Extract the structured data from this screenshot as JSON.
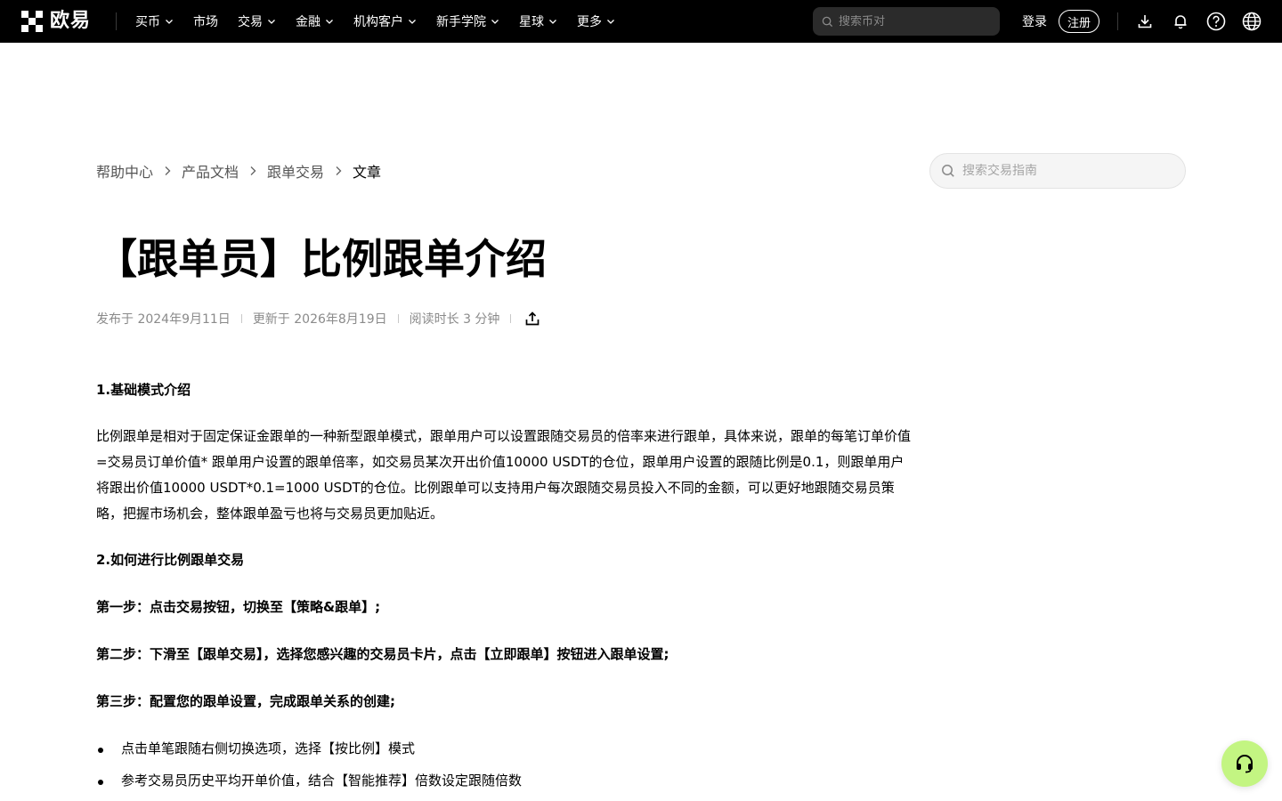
{
  "brand": {
    "name": "欧易"
  },
  "nav": {
    "items": [
      {
        "label": "买币",
        "has_dropdown": true
      },
      {
        "label": "市场",
        "has_dropdown": false
      },
      {
        "label": "交易",
        "has_dropdown": true
      },
      {
        "label": "金融",
        "has_dropdown": true
      },
      {
        "label": "机构客户",
        "has_dropdown": true
      },
      {
        "label": "新手学院",
        "has_dropdown": true
      },
      {
        "label": "星球",
        "has_dropdown": true
      },
      {
        "label": "更多",
        "has_dropdown": true
      }
    ],
    "search_placeholder": "搜索币对",
    "login_label": "登录",
    "register_label": "注册",
    "icons": [
      "download-icon",
      "bell-icon",
      "help-icon",
      "globe-icon"
    ]
  },
  "breadcrumb": {
    "items": [
      "帮助中心",
      "产品文档",
      "跟单交易"
    ],
    "current": "文章"
  },
  "help_search": {
    "placeholder": "搜索交易指南"
  },
  "article": {
    "title": "【跟单员】比例跟单介绍",
    "published": "发布于 2024年9月11日",
    "updated": "更新于 2026年8月19日",
    "read_time": "阅读时长 3 分钟",
    "sections": {
      "h1": "1.基础模式介绍",
      "p1": "比例跟单是相对于固定保证金跟单的一种新型跟单模式，跟单用户可以设置跟随交易员的倍率来进行跟单，具体来说，跟单的每笔订单价值=交易员订单价值* 跟单用户设置的跟单倍率，如交易员某次开出价值10000 USDT的仓位，跟单用户设置的跟随比例是0.1，则跟单用户将跟出价值10000 USDT*0.1=1000 USDT的仓位。比例跟单可以支持用户每次跟随交易员投入不同的金额，可以更好地跟随交易员策略，把握市场机会，整体跟单盈亏也将与交易员更加贴近。",
      "h2": "2.如何进行比例跟单交易",
      "step1": "第一步：点击交易按钮，切换至【策略&跟单】;",
      "step2": "第二步：下滑至【跟单交易】，选择您感兴趣的交易员卡片，点击【立即跟单】按钮进入跟单设置;",
      "step3": "第三步：配置您的跟单设置，完成跟单关系的创建;",
      "bullets": [
        "点击单笔跟随右侧切换选项，选择【按比例】模式",
        "参考交易员历史平均开单价值，结合【智能推荐】倍数设定跟随倍数"
      ]
    }
  },
  "colors": {
    "nav_bg": "#000000",
    "support_button": "#c3f582",
    "muted_text": "#8a8a8a"
  },
  "support": {
    "icon": "headset-icon"
  }
}
